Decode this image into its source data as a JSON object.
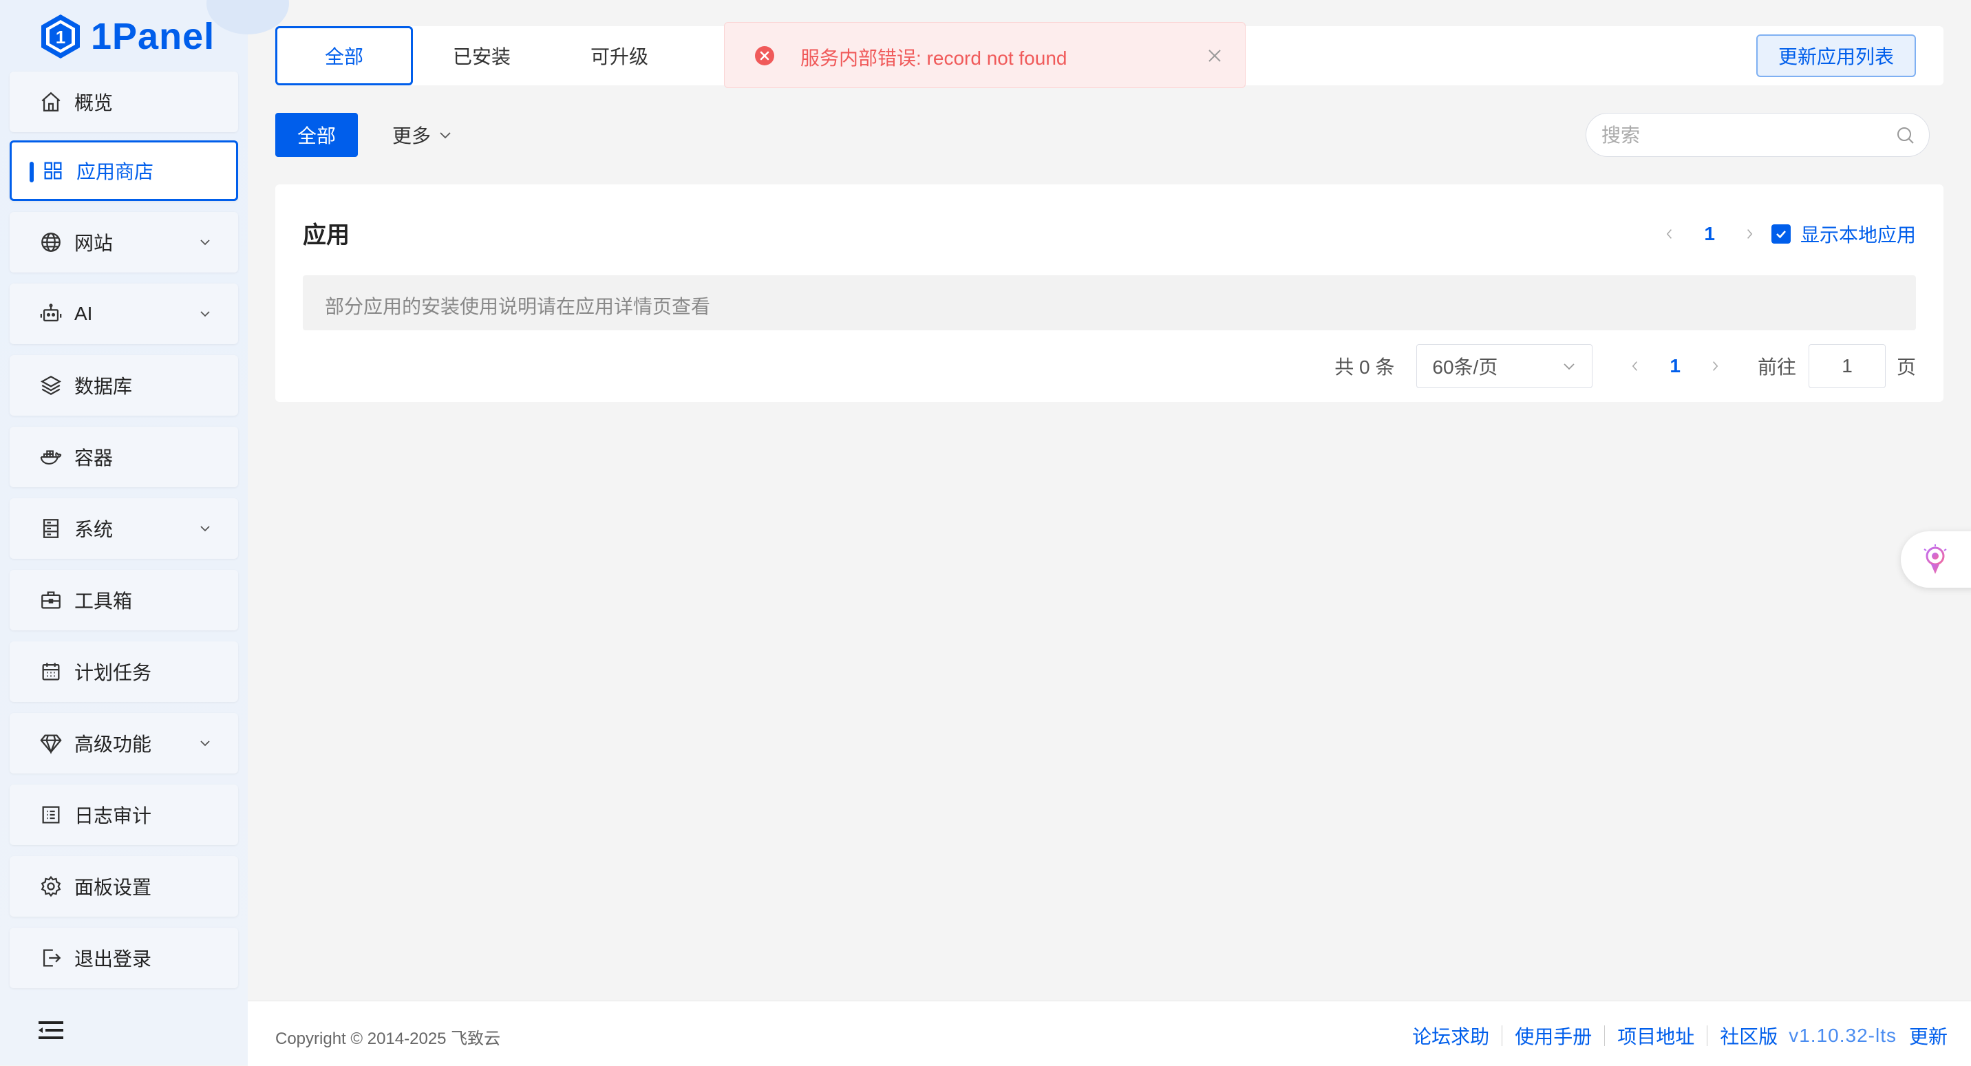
{
  "app": {
    "logo_text": "1Panel"
  },
  "sidebar": {
    "items": [
      {
        "label": "概览",
        "icon": "home-icon",
        "active": false,
        "has_children": false
      },
      {
        "label": "应用商店",
        "icon": "grid-icon",
        "active": true,
        "has_children": false
      },
      {
        "label": "网站",
        "icon": "globe-icon",
        "active": false,
        "has_children": true
      },
      {
        "label": "AI",
        "icon": "robot-icon",
        "active": false,
        "has_children": true
      },
      {
        "label": "数据库",
        "icon": "layers-icon",
        "active": false,
        "has_children": false
      },
      {
        "label": "容器",
        "icon": "docker-icon",
        "active": false,
        "has_children": false
      },
      {
        "label": "系统",
        "icon": "server-icon",
        "active": false,
        "has_children": true
      },
      {
        "label": "工具箱",
        "icon": "toolbox-icon",
        "active": false,
        "has_children": false
      },
      {
        "label": "计划任务",
        "icon": "calendar-icon",
        "active": false,
        "has_children": false
      },
      {
        "label": "高级功能",
        "icon": "diamond-icon",
        "active": false,
        "has_children": true
      },
      {
        "label": "日志审计",
        "icon": "log-icon",
        "active": false,
        "has_children": false
      },
      {
        "label": "面板设置",
        "icon": "gear-icon",
        "active": false,
        "has_children": false
      },
      {
        "label": "退出登录",
        "icon": "logout-icon",
        "active": false,
        "has_children": false
      }
    ]
  },
  "tabs": [
    {
      "label": "全部",
      "active": true
    },
    {
      "label": "已安装",
      "active": false
    },
    {
      "label": "可升级",
      "active": false
    }
  ],
  "toolbar": {
    "update_list_label": "更新应用列表"
  },
  "toast": {
    "message": "服务内部错误: record not found",
    "type": "error"
  },
  "filter": {
    "all_label": "全部",
    "more_label": "更多"
  },
  "search": {
    "placeholder": "搜索",
    "value": ""
  },
  "apps_card": {
    "title": "应用",
    "page": "1",
    "show_local_label": "显示本地应用",
    "show_local_checked": true,
    "notice": "部分应用的安装使用说明请在应用详情页查看"
  },
  "pagination": {
    "total_label": "共 0 条",
    "page_size": "60条/页",
    "current_page": "1",
    "goto_label": "前往",
    "goto_value": "1",
    "page_suffix": "页"
  },
  "footer": {
    "copyright": "Copyright © 2014-2025 飞致云",
    "links": [
      "论坛求助",
      "使用手册",
      "项目地址",
      "社区版"
    ],
    "version": "v1.10.32-lts",
    "update_label": "更新"
  },
  "colors": {
    "accent": "#005eeb",
    "error": "#f05a5a",
    "error_bg": "#fdeded"
  }
}
